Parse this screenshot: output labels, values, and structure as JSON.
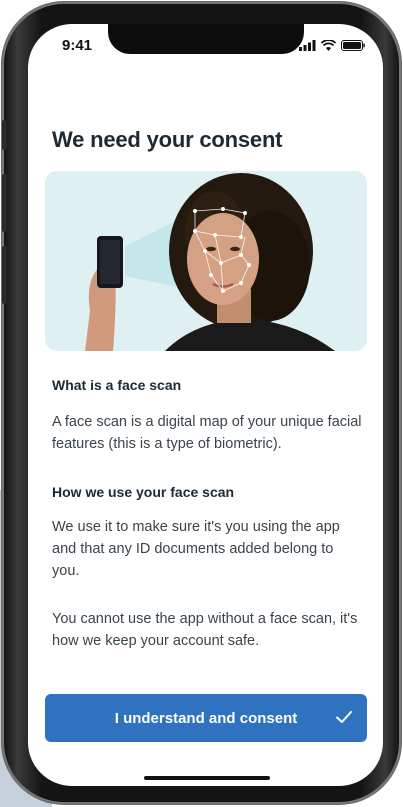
{
  "status_bar": {
    "time": "9:41"
  },
  "page": {
    "title": "We need your consent"
  },
  "sections": [
    {
      "heading": "What is a face scan",
      "paragraphs": [
        "A face scan is a digital map of your unique facial features (this is a type of biometric)."
      ]
    },
    {
      "heading": "How we use your face scan",
      "paragraphs": [
        "We use it to make sure it's you using the app and that any ID documents added belong to you.",
        "You cannot use the app without a face scan, it's how we keep your account safe."
      ]
    }
  ],
  "button": {
    "label": "I understand and consent",
    "icon": "check-icon"
  },
  "colors": {
    "primary": "#2f73c0",
    "hero_bg": "#dff0f2",
    "text_dark": "#1e2a33",
    "text_body": "#3a444d"
  }
}
